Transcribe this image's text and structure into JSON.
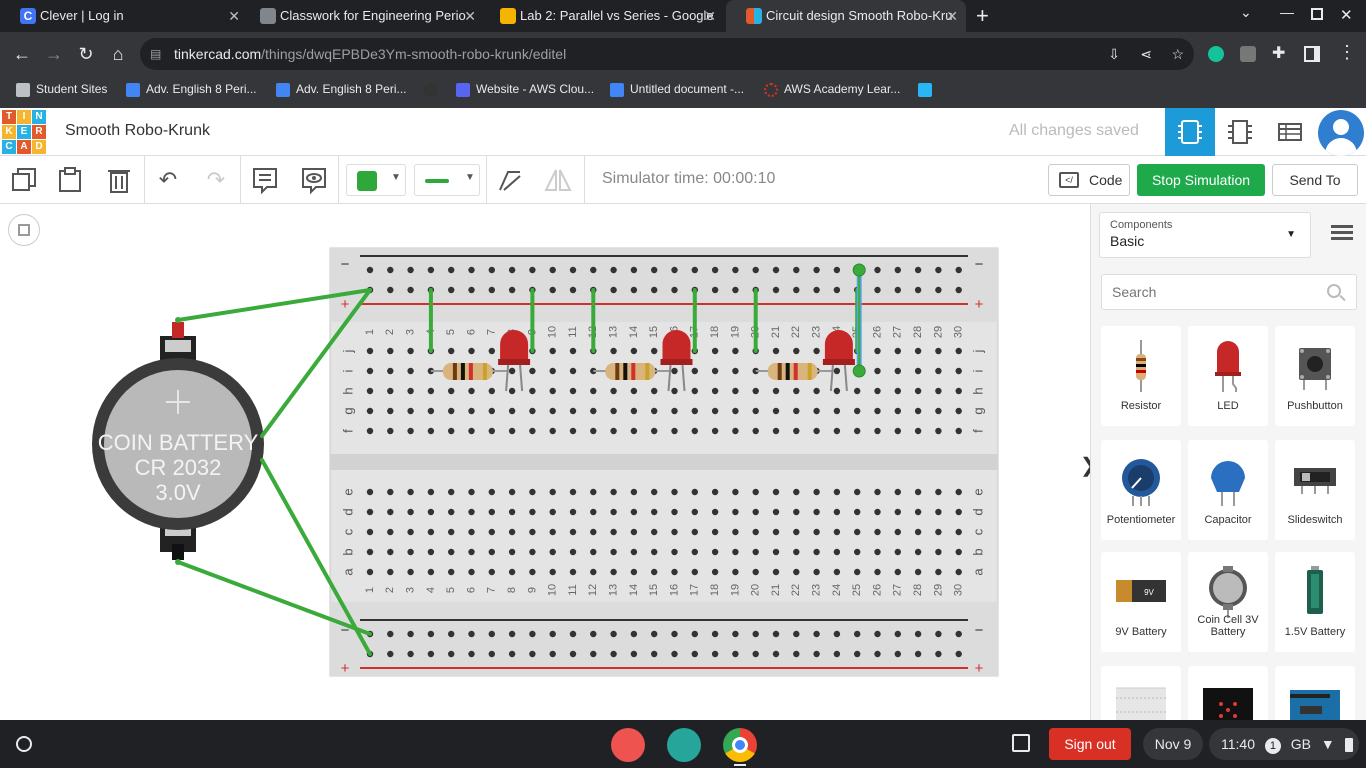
{
  "browser": {
    "tabs": [
      {
        "title": "Clever | Log in",
        "icon": "clever-icon",
        "color": "#4274f6"
      },
      {
        "title": "Classwork for Engineering Perio",
        "icon": "classroom-icon",
        "color": "#5f6368"
      },
      {
        "title": "Lab 2: Parallel vs Series - Google",
        "icon": "slides-icon",
        "color": "#f4b400"
      },
      {
        "title": "Circuit design Smooth Robo-Kru",
        "icon": "tinkercad-icon",
        "color": "#e25a2b"
      }
    ],
    "url_domain": "tinkercad.com",
    "url_path": "/things/dwqEPBDe3Ym-smooth-robo-krunk/editel",
    "bookmarks": [
      {
        "label": "Student Sites",
        "icon": "folder-icon"
      },
      {
        "label": "Adv. English 8 Peri...",
        "icon": "classroom-icon"
      },
      {
        "label": "Adv. English 8 Peri...",
        "icon": "classroom-icon"
      },
      {
        "label": "",
        "icon": "github-icon"
      },
      {
        "label": "Website - AWS Clou...",
        "icon": "cloud-icon"
      },
      {
        "label": "Untitled document -...",
        "icon": "docs-icon"
      },
      {
        "label": "AWS Academy Lear...",
        "icon": "aws-icon"
      },
      {
        "label": "",
        "icon": "extension-icon"
      }
    ]
  },
  "app": {
    "logo_letters": [
      "T",
      "I",
      "N",
      "K",
      "E",
      "R",
      "C",
      "A",
      "D"
    ],
    "design_title": "Smooth Robo-Krunk",
    "save_status": "All changes saved"
  },
  "toolbar": {
    "simulator_time": "Simulator time: 00:00:10",
    "code_label": "Code",
    "stop_label": "Stop Simulation",
    "send_to_label": "Send To",
    "fill_color": "#2ea83a"
  },
  "canvas": {
    "battery_line1": "COIN BATTERY",
    "battery_line2": "CR 2032",
    "battery_line3": "3.0V",
    "rail_minus": "−",
    "rail_plus": "+",
    "row_letters_top": [
      "j",
      "i",
      "h",
      "g",
      "f"
    ],
    "row_letters_bottom": [
      "e",
      "d",
      "c",
      "b",
      "a"
    ],
    "column_numbers": [
      "1",
      "2",
      "3",
      "4",
      "5",
      "6",
      "7",
      "8",
      "9",
      "10",
      "11",
      "12",
      "13",
      "14",
      "15",
      "16",
      "17",
      "18",
      "19",
      "20",
      "21",
      "22",
      "23",
      "24",
      "25",
      "26",
      "27",
      "28",
      "29",
      "30"
    ],
    "collapse_arrow": "❯"
  },
  "panel": {
    "components_label": "Components",
    "components_value": "Basic",
    "search_placeholder": "Search",
    "items": [
      {
        "label": "Resistor",
        "icon": "resistor-icon"
      },
      {
        "label": "LED",
        "icon": "led-icon"
      },
      {
        "label": "Pushbutton",
        "icon": "pushbutton-icon"
      },
      {
        "label": "Potentiometer",
        "icon": "potentiometer-icon"
      },
      {
        "label": "Capacitor",
        "icon": "capacitor-icon"
      },
      {
        "label": "Slideswitch",
        "icon": "slideswitch-icon"
      },
      {
        "label": "9V Battery",
        "icon": "9v-battery-icon"
      },
      {
        "label": "Coin Cell 3V Battery",
        "icon": "coin-cell-icon"
      },
      {
        "label": "1.5V Battery",
        "icon": "aa-battery-icon"
      },
      {
        "label": "",
        "icon": "breadboard-icon"
      },
      {
        "label": "",
        "icon": "microbit-icon"
      },
      {
        "label": "",
        "icon": "arduino-icon"
      }
    ],
    "battery_9v_text": "9V"
  },
  "shelf": {
    "sign_out": "Sign out",
    "date": "Nov 9",
    "time": "11:40",
    "notification_count": "1",
    "locale": "GB"
  }
}
